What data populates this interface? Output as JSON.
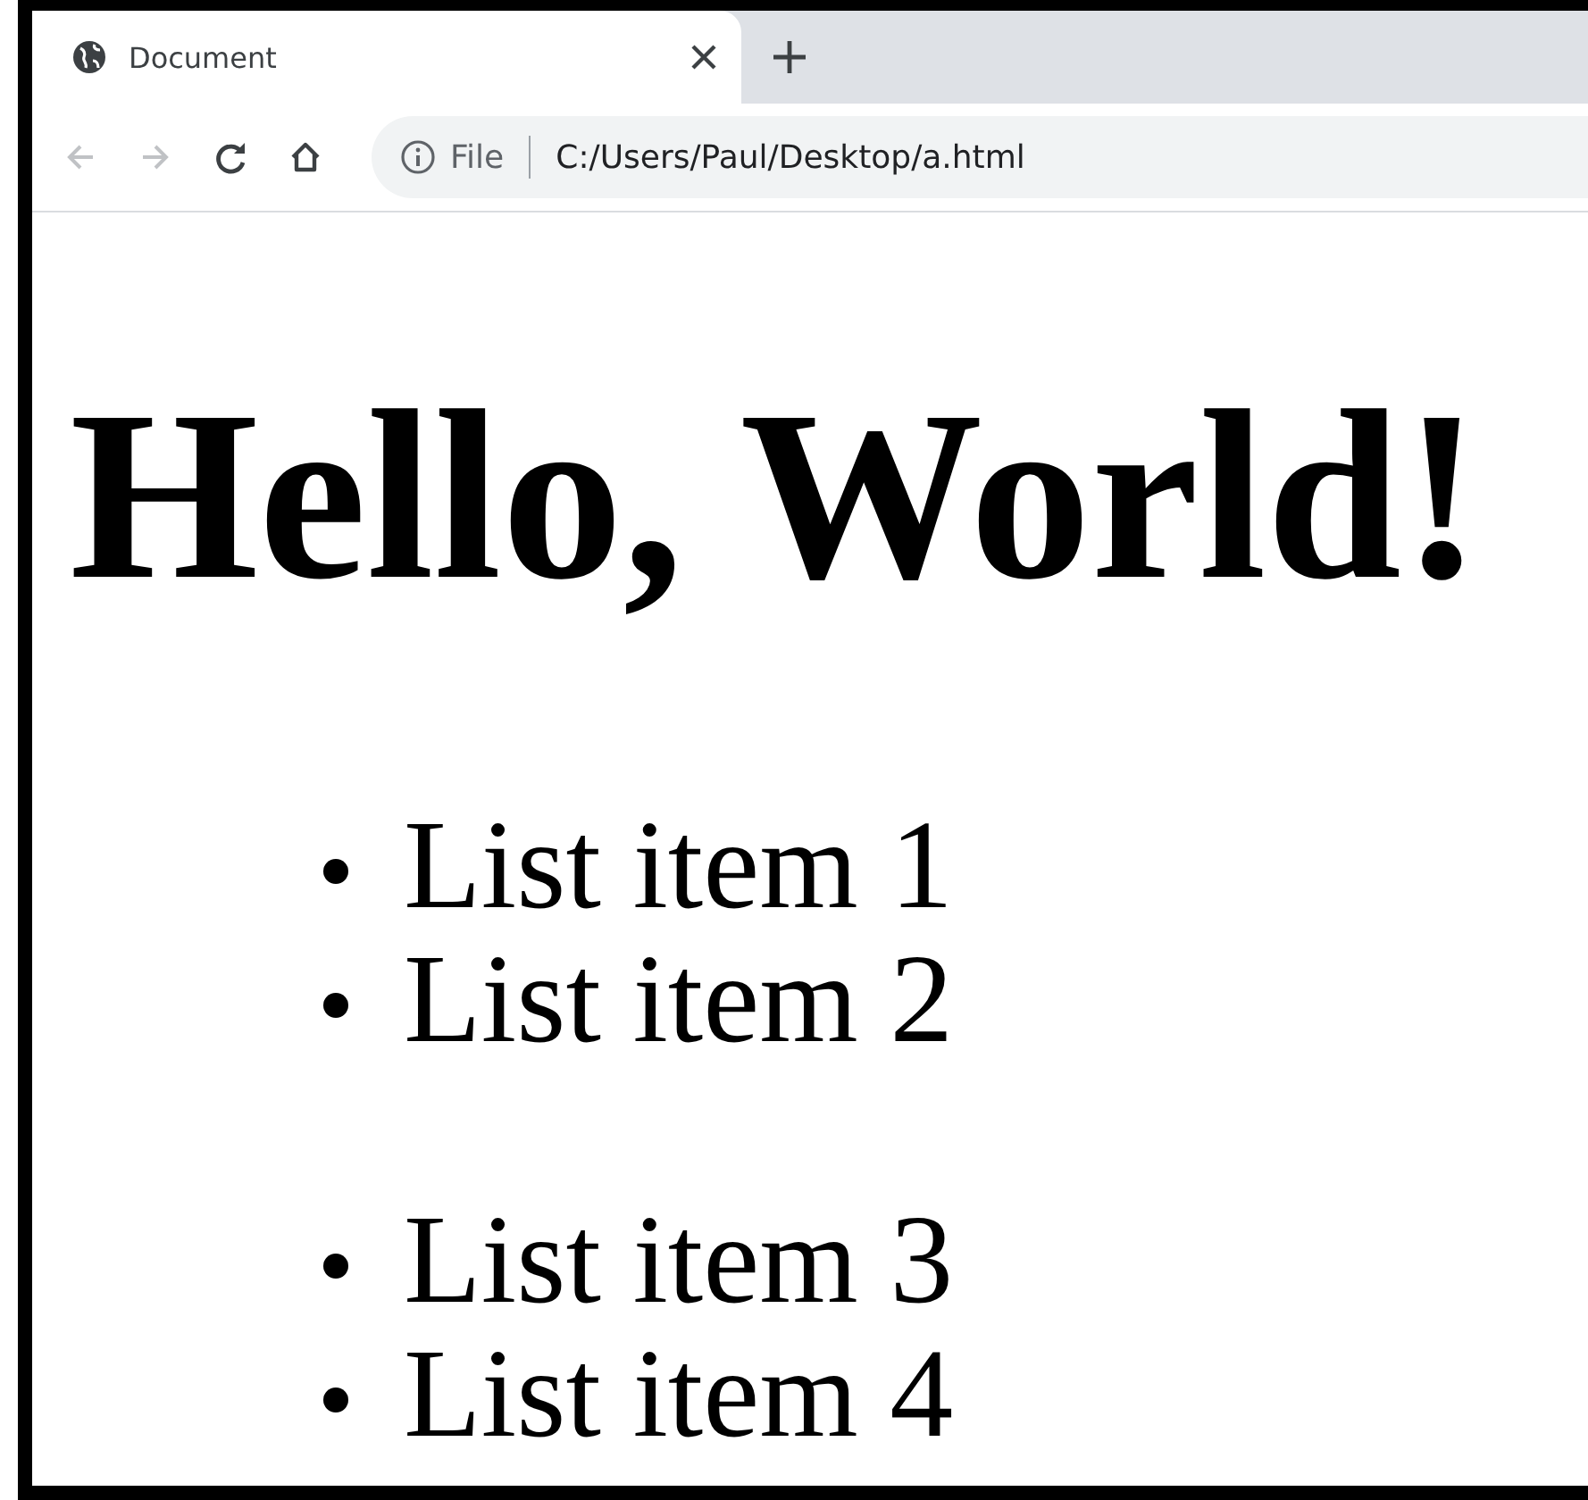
{
  "tabs": [
    {
      "title": "Document",
      "selected": true
    }
  ],
  "nav_buttons": [
    {
      "kind": "back",
      "disabled": true
    },
    {
      "kind": "forward",
      "disabled": true
    },
    {
      "kind": "reload",
      "disabled": false
    },
    {
      "kind": "home",
      "disabled": false
    }
  ],
  "address_bar": {
    "scheme": "File",
    "url": "C:/Users/Paul/Desktop/a.html"
  },
  "page": {
    "heading": "Hello, World!",
    "lists": [
      [
        "List item 1",
        "List item 2"
      ],
      [
        "List item 3",
        "List item 4"
      ]
    ]
  }
}
